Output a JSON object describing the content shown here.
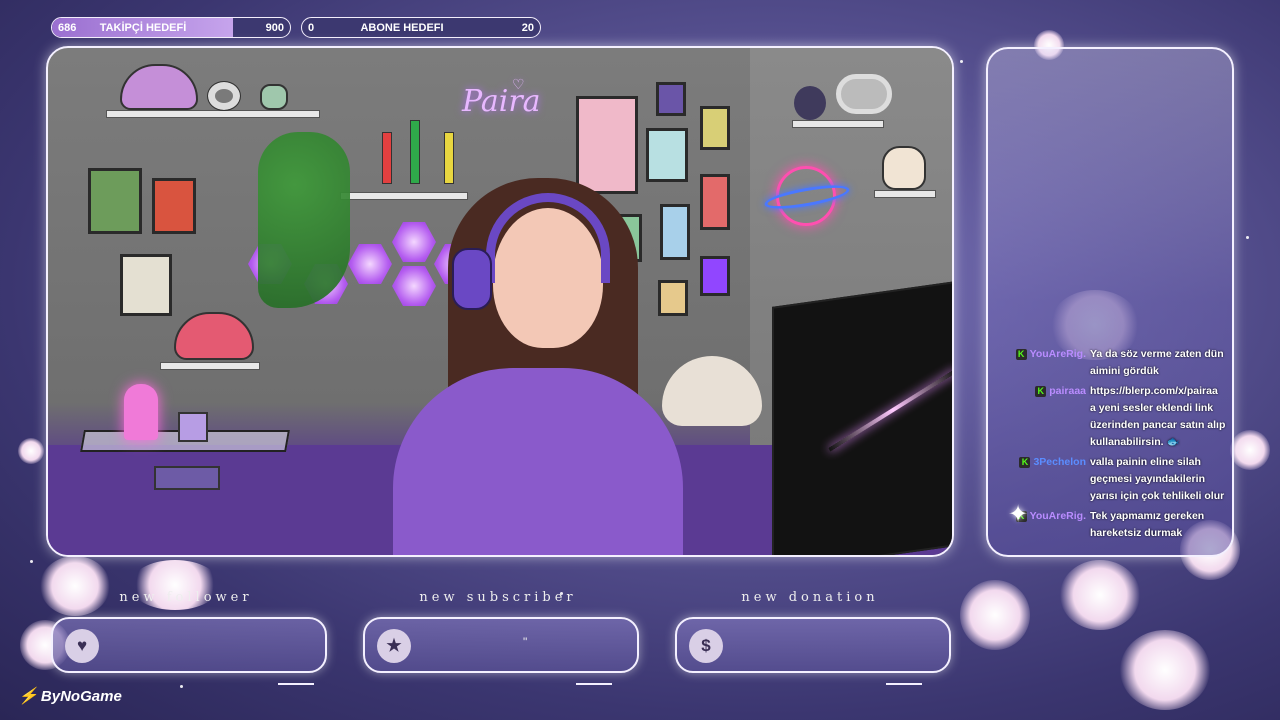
{
  "goals": {
    "follower": {
      "current": "686",
      "title": "TAKİPÇİ HEDEFİ",
      "target": "900",
      "progress": 0.76
    },
    "subscriber": {
      "current": "0",
      "title": "ABONE HEDEFI",
      "target": "20",
      "progress": 0.0
    }
  },
  "scene": {
    "neon_sign": "Paira"
  },
  "chat": {
    "messages": [
      {
        "user": "YouAreRig.",
        "color": "purple",
        "text": "Ya da söz verme zaten dün aimini gördük"
      },
      {
        "user": "pairaaa",
        "color": "purple",
        "text": "https://blerp.com/x/pairaa a yeni sesler eklendi link üzerinden pancar satın alıp kullanabilirsin. 🐟"
      },
      {
        "user": "3Pechelon",
        "color": "blue",
        "text": "valla painin eline silah geçmesi yayındakilerin yarısı için çok tehlikeli olur"
      },
      {
        "user": "YouAreRig.",
        "color": "purple",
        "text": "Tek yapmamız gereken hareketsiz durmak"
      }
    ]
  },
  "alerts": {
    "follower": {
      "title": "new follower",
      "icon": "heart-icon",
      "glyph": "♥",
      "value": ""
    },
    "subscriber": {
      "title": "new subscriber",
      "icon": "star-icon",
      "glyph": "★",
      "value": "\""
    },
    "donation": {
      "title": "new donation",
      "icon": "dollar-icon",
      "glyph": "$",
      "value": ""
    }
  },
  "brand": {
    "name": "ByNoGame"
  }
}
